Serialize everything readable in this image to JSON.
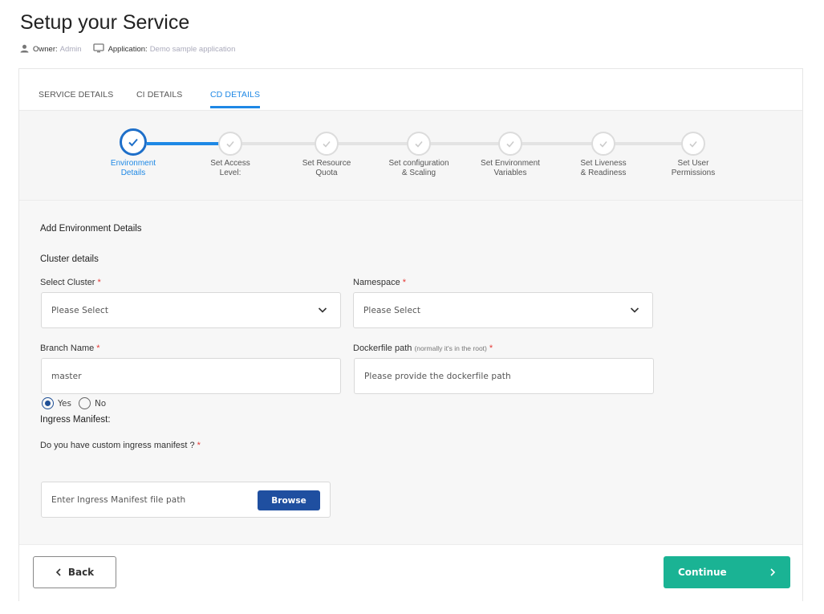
{
  "header": {
    "title": "Setup your Service",
    "owner_label": "Owner:",
    "owner_value": "Admin",
    "app_label": "Application:",
    "app_value": "Demo sample application"
  },
  "tabs": [
    {
      "label": "SERVICE DETAILS",
      "active": false
    },
    {
      "label": "CI DETAILS",
      "active": false
    },
    {
      "label": "CD DETAILS",
      "active": true
    }
  ],
  "steps": [
    {
      "line1": "Environment",
      "line2": "Details",
      "state": "active"
    },
    {
      "line1": "Set Access",
      "line2": "Level:",
      "state": "pending"
    },
    {
      "line1": "Set Resource",
      "line2": "Quota",
      "state": "pending"
    },
    {
      "line1": "Set configuration",
      "line2": "& Scaling",
      "state": "pending"
    },
    {
      "line1": "Set Environment",
      "line2": "Variables",
      "state": "pending"
    },
    {
      "line1": "Set Liveness",
      "line2": "& Readiness",
      "state": "pending"
    },
    {
      "line1": "Set User",
      "line2": "Permissions",
      "state": "pending"
    }
  ],
  "form": {
    "section_title": "Add Environment Details",
    "cluster_heading": "Cluster details",
    "cluster": {
      "label": "Select Cluster",
      "value": "Please Select"
    },
    "namespace": {
      "label": "Namespace",
      "value": "Please Select"
    },
    "branch": {
      "label": "Branch Name",
      "value": "master"
    },
    "dockerfile": {
      "label": "Dockerfile path",
      "hint": "(normally it's in the root)",
      "placeholder": "Please provide the dockerfile path"
    },
    "ingress_heading": "Ingress Manifest:",
    "ingress_question": "Do you have custom ingress manifest ?",
    "radio_yes": "Yes",
    "radio_no": "No",
    "radio_selected": "Yes",
    "ingress_path_placeholder": "Enter Ingress Manifest file path",
    "browse_label": "Browse",
    "required_mark": "*"
  },
  "footer": {
    "back_label": "Back",
    "continue_label": "Continue"
  },
  "colors": {
    "accent": "#1e88e5",
    "stepper_active": "#1e6fc9",
    "browse": "#1f4fa0",
    "continue": "#1ab394",
    "required": "#e53935"
  },
  "icons": {
    "owner": "user-icon",
    "application": "monitor-icon",
    "step": "check-icon",
    "select": "chevron-down-icon",
    "back": "chevron-left-icon",
    "continue": "chevron-right-icon"
  }
}
